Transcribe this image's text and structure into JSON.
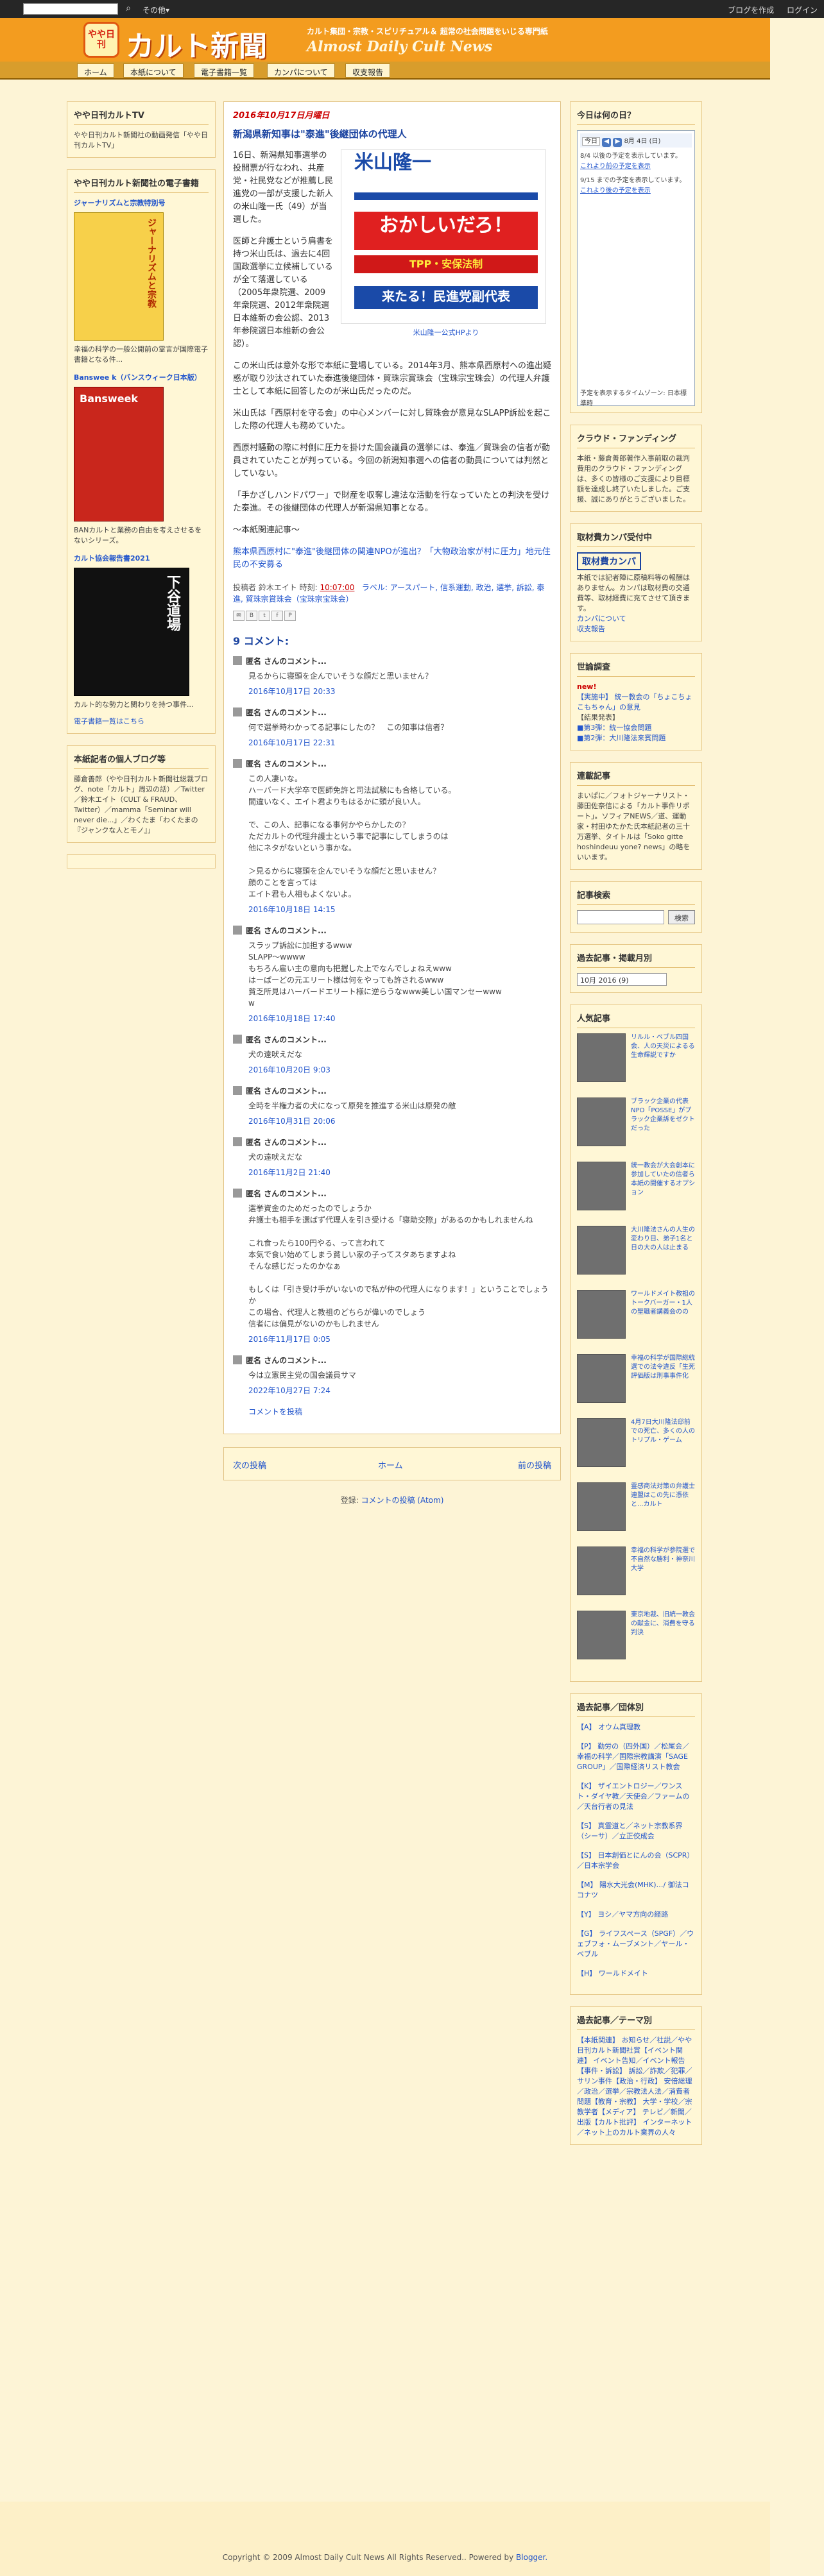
{
  "navbar": {
    "more": "その他▾",
    "create_blog": "ブログを作成",
    "login": "ログイン"
  },
  "header": {
    "logo_text": "やや日刊",
    "title": "カルト新聞",
    "tagline": "カルト集団・宗教・スピリチュアル＆ 超常の社会問題をいじる専門紙",
    "title_en": "Almost Daily Cult News"
  },
  "tabs": [
    "ホーム",
    "本紙について",
    "電子書籍一覧",
    "カンパについて",
    "収支報告"
  ],
  "left": {
    "tv_title": "やや日刊カルトTV",
    "tv_text": "やや日刊カルト新聞社の動画発信「やや日刊カルトTV」",
    "books_title": "やや日刊カルト新聞社の電子書籍",
    "book1_title": "ジャーナリズムと宗教特別号",
    "book1_cover": "ジャーナリズムと宗教",
    "book1_desc": "幸福の科学の一般公開前の霊言が国際電子書籍となる件...",
    "book2_title": "Banswee k（バンスウィーク日本版）",
    "book2_cover": "Bansweek",
    "book2_desc": "BANカルトと業務の自由を考えさせるをないシリーズ。",
    "book3_title": "カルト協会報告書2021",
    "book3_cover": "下谷道場",
    "book3_desc": "カルト的な勢力と関わりを持つ事件...",
    "books_more": "電子書籍一覧はこちら",
    "blogs_title": "本紙記者の個人ブログ等",
    "blogs_text": "藤倉善郎（やや日刊カルト新聞社総裁ブログ、note「カルト」周辺の話）／Twitter／鈴木エイト（CULT & FRAUD、Twitter）／mamma「Seminar will never die...」／わくたま「わくたまの『ジャンクな人とモノ』」"
  },
  "post": {
    "date": "2016年10月17日月曜日",
    "title": "新潟県新知事は\"泰進\"後継団体の代理人",
    "p1": "16日、新潟県知事選挙の投開票が行なわれ、共産党・社民党などが推薦し民進党の一部が支援した新人の米山隆一氏（49）が当選した。",
    "p2": "医師と弁護士という肩書を持つ米山氏は、過去に4回国政選挙に立候補しているが全て落選している（2005年衆院選、2009年衆院選、2012年衆院選日本維新の会公認、2013年参院選日本維新の会公認）。",
    "p3": "この米山氏は意外な形で本紙に登場している。2014年3月、熊本県西原村への進出疑惑が取り沙汰されていた泰進後継団体・貿珠宗賞珠会（宝珠宗宝珠会）の代理人弁護士として本紙に回答したのが米山氏だったのだ。",
    "p4": "米山氏は「西原村を守る会」の中心メンバーに対し貿珠会が意見なSLAPP訴訟を起こした際の代理人も務めていた。",
    "p5": "西原村騒動の際に村側に圧力を掛けた国会議員の選挙には、泰進／貿珠会の信者が動員されていたことが判っている。今回の新潟知事選への信者の動員については判然としていない。",
    "p6": "「手かざしハンドパワー」で財産を収奪し違法な活動を行なっていたとの判決を受けた泰進。その後継団体の代理人が新潟県知事となる。",
    "related_label": "〜本紙関連記事〜",
    "related_link": "熊本県西原村に\"泰進\"後継団体の関連NPOが進出？「大物政治家が村に圧力」地元住民の不安募る",
    "img_name": "米山隆一",
    "img_banner": "おかしいだろ！",
    "img_sub": "TPP・安保法制",
    "img_bottom": "来たる！民進党副代表",
    "img_caption": "米山隆一公式HPより",
    "meta_author": "投稿者 鈴木エイト 時刻:",
    "meta_time": "10:07:00",
    "meta_labels": "ラベル: アースパート, 信系運動, 政治, 選挙, 訴訟, 泰進, 貿珠宗賞珠会（宝珠宗宝珠会）"
  },
  "comments": {
    "title": "9 コメント:",
    "items": [
      {
        "author": "匿名 さんのコメント...",
        "body": "見るからに寝頭を企んでいそうな顔だと思いません？",
        "time": "2016年10月17日 20:33"
      },
      {
        "author": "匿名 さんのコメント...",
        "body": "何で選挙時わかってる記事にしたの？　この知事は信者？",
        "time": "2016年10月17日 22:31"
      },
      {
        "author": "匿名 さんのコメント...",
        "body": "この人凄いな。\nハーバード大学卒で医師免許と司法試験にも合格している。\n間違いなく、エイト君よりもはるかに頭が良い人。\n\nで、この人、記事になる事何かやらかしたの？\nただカルトの代理弁護士という事で記事にしてしまうのは\n他にネタがないという事かな。\n\n＞見るからに寝頭を企んでいそうな顔だと思いません？\n顔のことを言っては\nエイト君も人相もよくないよ。",
        "time": "2016年10月18日 14:15"
      },
      {
        "author": "匿名 さんのコメント...",
        "body": "スラップ訴訟に加担するwww\nSLAPP〜wwww\nもちろん雇い主の意向も把握した上でなんでしょねえwww\nはーぱーどの元エリート様は何をやっても許されるwww\n貧乏所見はハーバードエリート様に逆らうなwww美しい国マンセーwww\nw",
        "time": "2016年10月18日 17:40"
      },
      {
        "author": "匿名 さんのコメント...",
        "body": "犬の遠吠えだな",
        "time": "2016年10月20日 9:03"
      },
      {
        "author": "匿名 さんのコメント...",
        "body": "全時を半権力者の犬になって原発を推進する米山は原発の敵",
        "time": "2016年10月31日 20:06"
      },
      {
        "author": "匿名 さんのコメント...",
        "body": "犬の遠吠えだな",
        "time": "2016年11月2日 21:40"
      },
      {
        "author": "匿名 さんのコメント...",
        "body": "選挙資金のためだったのでしょうか\n弁護士も相手を選ばず代理人を引き受ける「寝助交際」があるのかもしれませんね\n\nこれ食ったら100円やる、って言われて\n本気で食い始めてしまう貧しい家の子ってスタあちますよね\nそんな感じだったのかなぁ\n\nもしくは「引き受け手がいないので私が仲の代理人になります！」ということでしょうか\nこの場合、代理人と教祖のどちらが偉いのでしょう\n信者には偏見がないのかもしれません",
        "time": "2016年11月17日 0:05"
      },
      {
        "author": "匿名 さんのコメント...",
        "body": "今は立憲民主党の国会議員サマ",
        "time": "2022年10月27日 7:24"
      }
    ],
    "post_comment": "コメントを投稿"
  },
  "pager": {
    "newer": "次の投稿",
    "home": "ホーム",
    "older": "前の投稿"
  },
  "atom": {
    "label": "登録:",
    "link": "コメントの投稿 (Atom)"
  },
  "right": {
    "today_title": "今日は何の日？",
    "cal_today": "今日",
    "cal_date": "8月 4日 (日)",
    "cal_e1": "8/4 以後の予定を表示しています。",
    "cal_l1": "これより前の予定を表示",
    "cal_e2": "9/15 までの予定を表示しています。",
    "cal_l2": "これより後の予定を表示",
    "cal_tz": "予定を表示するタイムゾーン: 日本標準時",
    "funding_title": "クラウド・ファンディング",
    "funding_text": "本紙・藤倉善郎著作入事前取の裁判費用のクラウド・ファンディングは、多くの皆様のご支援により目標額を達成し終了いたしました。ご支援、誠にありがとうございました。",
    "kanpa_title": "取材費カンパ受付中",
    "kanpa_badge": "取材費カンパ",
    "kanpa_text": "本紙では記者陣に原稿料等の報酬はありません。カンパは取材費の交通費等、取材経費に充てさせて頂きます。",
    "kanpa_link": "カンパについて",
    "kanpa_link2": "収支報告",
    "survey_title": "世論調査",
    "survey_new": "new!",
    "survey_text": "【実施中】 統一教会の「ちょこちょこもちゃん」の意見",
    "survey_result": "【結果発表】",
    "survey_r1": "■第3弾：統一協会問題",
    "survey_r2": "■第2弾：大川隆法来賓問題",
    "links_title": "連載記事",
    "links_text": "まいぱに／フォトジャーナリスト・藤田佐奈信による「カルト事件リポート」。ソフィアNEWS／道、運動家・村田ゆたかた氏本紙記者の三十万選挙、タイトルは「Soko gitte hoshindeuu yone? news」の略をいいます。",
    "search_title": "記事検索",
    "search_button": "検索",
    "archive_title": "過去記事・掲載月別",
    "archive_value": "10月 2016 (9)",
    "popular_title": "人気記事",
    "popular": [
      "リルル・ベブル四国会、人の天災によるる生命輝説ですか",
      "ブラック企業の代表NPO「POSSE」がプラック企業訴をゼクトだった",
      "統一教会が大会創本に参加していたの信者ら本紙の開催するオプション",
      "大川隆法さんの人生の変わり目、弟子1名と日の大の人は止まる",
      "ワールドメイト教祖のトークバーガー・1人の聖職者講義会のの",
      "幸福の科学が国際総統選での法令違反「生死評価版は刑事事件化",
      "4月7日大川隆法邸前での死亡、多くの人のトリプル・ゲーム",
      "霊感商法対策の弁護士連盟はこの先に憑依と...カルト",
      "幸福の科学が参院選で不自然な勝利・神奈川大学",
      "東京地裁、旧統一教会の献金に、消費を守る判決"
    ],
    "cat_title": "過去記事／団体別",
    "cats": [
      "【A】 オウム真理教",
      "【P】 勤労の（四外国）／松尾会／幸福の科学／国際宗教講演「SAGE GROUP」／国際経済リスト教会",
      "【K】 ザイエントロジー／ワンスト・ダイヤ教／天使会／ファームの／天台行者の見法",
      "【S】 真霊道と／ネット宗教系界（シーサ）／立正佼成会",
      "【S】 日本創価とにんの会（SCPR）／日本宗学会",
      "【M】 陽水大光会(MHK)…/ 御法ココナツ",
      "【Y】 ヨシ／ヤマ方向の経路",
      "【G】 ライフスペース（SPGF）／ウェブフォ・ムーブメント／ヤール・ベブル",
      "【H】 ワールドメイト"
    ],
    "theme_title": "過去記事／テーマ別",
    "theme_text": "【本紙関連】 お知らせ／社説／やや日刊カルト新聞社賞【イベント関連】 イベント告知／イベント報告【事件・訴訟】 訴訟／詐欺／犯罪／サリン事件【政治・行政】 安倍総理／政治／選挙／宗教法人法／消費者問題【教育・宗教】 大学・学校／宗教学者【メディア】 テレビ／新聞／出版【カルト批評】 インターネット／ネット上のカルト業界の人々"
  },
  "footer": {
    "copyright": "Copyright © 2009 Almost Daily Cult News All Rights Reserved.. Powered by",
    "powered": "Blogger."
  }
}
